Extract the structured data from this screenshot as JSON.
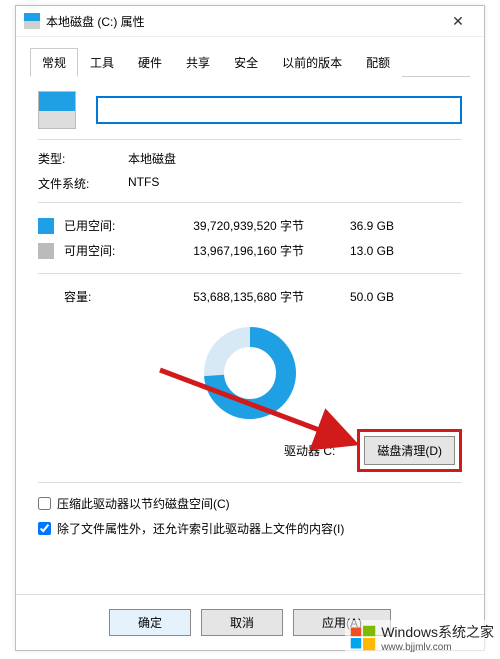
{
  "window": {
    "title": "本地磁盘 (C:) 属性"
  },
  "tabs": [
    {
      "label": "常规",
      "active": true
    },
    {
      "label": "工具",
      "active": false
    },
    {
      "label": "硬件",
      "active": false
    },
    {
      "label": "共享",
      "active": false
    },
    {
      "label": "安全",
      "active": false
    },
    {
      "label": "以前的版本",
      "active": false
    },
    {
      "label": "配额",
      "active": false
    }
  ],
  "general": {
    "type_label": "类型:",
    "type_value": "本地磁盘",
    "fs_label": "文件系统:",
    "fs_value": "NTFS",
    "used": {
      "label": "已用空间:",
      "bytes": "39,720,939,520 字节",
      "gb": "36.9 GB"
    },
    "free": {
      "label": "可用空间:",
      "bytes": "13,967,196,160 字节",
      "gb": "13.0 GB"
    },
    "capacity": {
      "label": "容量:",
      "bytes": "53,688,135,680 字节",
      "gb": "50.0 GB"
    },
    "drive_caption": "驱动器 C:",
    "cleanup_button": "磁盘清理(D)",
    "compress_checkbox": "压缩此驱动器以节约磁盘空间(C)",
    "index_checkbox": "除了文件属性外，还允许索引此驱动器上文件的内容(I)"
  },
  "buttons": {
    "ok": "确定",
    "cancel": "取消",
    "apply": "应用(A)"
  },
  "watermark": {
    "title": "Windows系统之家",
    "url": "www.bjjmlv.com"
  },
  "chart_data": {
    "type": "pie",
    "title": "",
    "series": [
      {
        "name": "已用空间",
        "value": 36.9,
        "color": "#1fa0e4"
      },
      {
        "name": "可用空间",
        "value": 13.0,
        "color": "#d6e9f5"
      }
    ],
    "unit": "GB",
    "total": 50.0
  }
}
